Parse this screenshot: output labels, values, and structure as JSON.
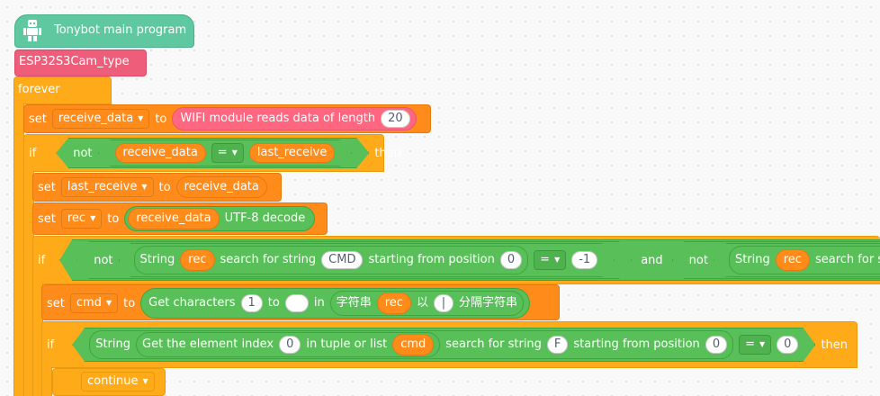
{
  "hat": {
    "label": "Tonybot main program",
    "icon": "robot-icon"
  },
  "ext_block": {
    "label": "ESP32S3Cam_type"
  },
  "forever": {
    "label": "forever"
  },
  "set1": {
    "set": "set",
    "var": "receive_data",
    "to": "to",
    "reporter": "WIFI module reads data of length",
    "length": "20"
  },
  "if1": {
    "if": "if",
    "not": "not",
    "left": "receive_data",
    "op": "=",
    "right": "last_receive",
    "then": "then"
  },
  "set2": {
    "set": "set",
    "var": "last_receive",
    "to": "to",
    "value": "receive_data"
  },
  "set3": {
    "set": "set",
    "var": "rec",
    "to": "to",
    "inner": "receive_data",
    "suffix": "UTF-8 decode"
  },
  "if2": {
    "if": "if",
    "not": "not",
    "string": "String",
    "var": "rec",
    "search": "search for string",
    "term": "CMD",
    "start": "starting from position",
    "pos": "0",
    "op": "=",
    "value": "-1",
    "and": "and",
    "not2": "not",
    "string2": "String",
    "var2": "rec",
    "search2": "search for string"
  },
  "set4": {
    "set": "set",
    "var": "cmd",
    "to": "to",
    "get_chars": "Get characters",
    "from": "1",
    "to2": "to",
    "end": "",
    "in": "in",
    "cn_string": "字符串",
    "rec": "rec",
    "cn_by": "以",
    "sep": "|",
    "cn_split": "分隔字符串"
  },
  "if3": {
    "if": "if",
    "string": "String",
    "get_index": "Get the element index",
    "index": "0",
    "in_tuple": "in tuple or list",
    "list_var": "cmd",
    "search": "search for string",
    "term": "F",
    "start": "starting from position",
    "pos": "0",
    "op": "=",
    "value": "0",
    "then": "then"
  },
  "continue": {
    "label": "continue"
  },
  "colors": {
    "events": "#5fc8a1",
    "extension": "#ee5e7a",
    "control": "#ffab19",
    "variables": "#ff8c1a",
    "operators": "#59c059",
    "functions": "#ff6680"
  }
}
